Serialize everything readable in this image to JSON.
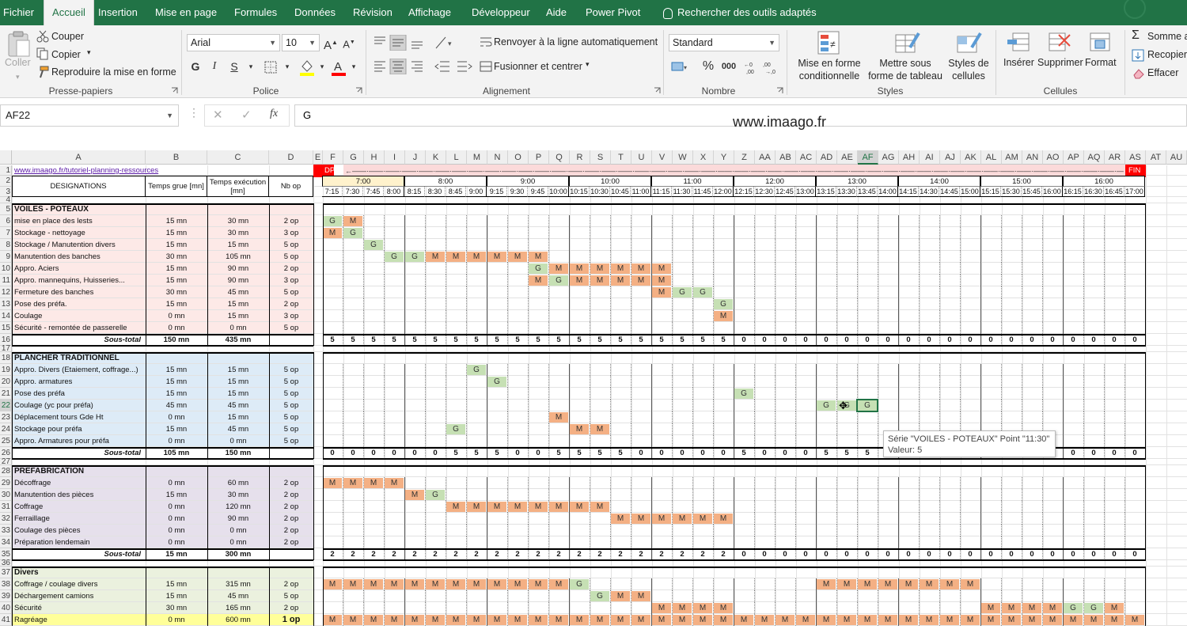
{
  "ribbon_tabs": [
    "Fichier",
    "Accueil",
    "Insertion",
    "Mise en page",
    "Formules",
    "Données",
    "Révision",
    "Affichage",
    "Développeur",
    "Aide",
    "Power Pivot",
    "Rechercher des outils adaptés"
  ],
  "ribbon": {
    "clipboard": {
      "paste": "Coller",
      "cut": "Couper",
      "copy": "Copier",
      "format_painter": "Reproduire la mise en forme",
      "label": "Presse-papiers"
    },
    "font": {
      "name": "Arial",
      "size": "10",
      "bold": "G",
      "italic": "I",
      "underline": "S",
      "label": "Police"
    },
    "alignment": {
      "wrap": "Renvoyer à la ligne automatiquement",
      "merge": "Fusionner et centrer",
      "label": "Alignement"
    },
    "number": {
      "format": "Standard",
      "label": "Nombre"
    },
    "styles": {
      "conditional": "Mise en forme conditionnelle",
      "table": "Mettre sous forme de tableau",
      "cell_styles": "Styles de cellules",
      "label": "Styles"
    },
    "cells": {
      "insert": "Insérer",
      "delete": "Supprimer",
      "format": "Format",
      "label": "Cellules"
    },
    "editing": {
      "autosum": "Somme a",
      "fill": "Recopier",
      "clear": "Effacer"
    }
  },
  "formula_bar": {
    "name_box": "AF22",
    "value": "G"
  },
  "watermark": "www.imaago.fr",
  "columns": [
    "A",
    "B",
    "C",
    "D",
    "E",
    "F",
    "G",
    "H",
    "I",
    "J",
    "K",
    "L",
    "M",
    "N",
    "O",
    "P",
    "Q",
    "R",
    "S",
    "T",
    "U",
    "V",
    "W",
    "X",
    "Y",
    "Z",
    "AA",
    "AB",
    "AC",
    "AD",
    "AE",
    "AF",
    "AG",
    "AH",
    "AI",
    "AJ",
    "AK",
    "AL",
    "AM",
    "AN",
    "AO",
    "AP",
    "AQ",
    "AR",
    "AS",
    "AT",
    "AU"
  ],
  "selected_column": "AF",
  "selected_row": "22",
  "header": {
    "link": "www.imaago.fr/tutoriel-planning-ressources",
    "designations": "DESIGNATIONS",
    "crane_time": "Temps grue [mn]",
    "exec_time": "Temps exécution [mn]",
    "nb_op": "Nb op",
    "start": "DPT",
    "end": "FIN",
    "arrow_text": "←——·——·——·——·——·——·——·——·——·——·——·——·——·——·——·——·——·——·——·——·——·——·——·——·——·——·——·——·——·——·——·——·——·——·——·——·——·——·——·——·——·——·——·——·——·——·——·——·——·——·——·——·——·——·——·——·——·——·——·——·——·——·——·——·——·——·——·——→"
  },
  "hours": [
    "7:00",
    "8:00",
    "9:00",
    "10:00",
    "11:00",
    "12:00",
    "13:00",
    "14:00",
    "15:00",
    "16:00"
  ],
  "quarters": [
    "7:15",
    "7:30",
    "7:45",
    "8:00",
    "8:15",
    "8:30",
    "8:45",
    "9:00",
    "9:15",
    "9:30",
    "9:45",
    "10:00",
    "10:15",
    "10:30",
    "10:45",
    "11:00",
    "11:15",
    "11:30",
    "11:45",
    "12:00",
    "12:15",
    "12:30",
    "12:45",
    "13:00",
    "13:15",
    "13:30",
    "13:45",
    "14:00",
    "14:15",
    "14:30",
    "14:45",
    "15:00",
    "15:15",
    "15:30",
    "15:45",
    "16:00",
    "16:15",
    "16:30",
    "16:45",
    "17:00"
  ],
  "rows": [
    {
      "n": "1",
      "type": "link"
    },
    {
      "n": "2",
      "type": "hdr"
    },
    {
      "n": "3",
      "type": "hdr"
    },
    {
      "n": "4",
      "type": "blank"
    },
    {
      "n": "5",
      "type": "section",
      "label": "VOILES - POTEAUX",
      "bg": "#fde9e7"
    },
    {
      "n": "6",
      "type": "task",
      "label": "mise en place des lests",
      "crane": "15 mn",
      "exec": "30 mn",
      "op": "2 op",
      "bg": "#fde9e7",
      "marks": "GM"
    },
    {
      "n": "7",
      "type": "task",
      "label": "Stockage - nettoyage",
      "crane": "15 mn",
      "exec": "30 mn",
      "op": "3 op",
      "bg": "#fde9e7",
      "marks": "MG"
    },
    {
      "n": "8",
      "type": "task",
      "label": "Stockage / Manutention divers",
      "crane": "15 mn",
      "exec": "15 mn",
      "op": "5 op",
      "bg": "#fde9e7",
      "marks": "..G"
    },
    {
      "n": "9",
      "type": "task",
      "label": "Manutention des banches",
      "crane": "30 mn",
      "exec": "105 mn",
      "op": "5 op",
      "bg": "#fde9e7",
      "marks": "...GGMMMMMM"
    },
    {
      "n": "10",
      "type": "task",
      "label": "Appro. Aciers",
      "crane": "15 mn",
      "exec": "90 mn",
      "op": "2 op",
      "bg": "#fde9e7",
      "marks": "..........GMMMMMM"
    },
    {
      "n": "11",
      "type": "task",
      "label": "Appro. mannequins, Huisseries...",
      "crane": "15 mn",
      "exec": "90 mn",
      "op": "3 op",
      "bg": "#fde9e7",
      "marks": "..........MGMMMMM"
    },
    {
      "n": "12",
      "type": "task",
      "label": "Fermeture des banches",
      "crane": "30 mn",
      "exec": "45 mn",
      "op": "5 op",
      "bg": "#fde9e7",
      "marks": "................MGG"
    },
    {
      "n": "13",
      "type": "task",
      "label": "Pose des préfa.",
      "crane": "15 mn",
      "exec": "15 mn",
      "op": "2 op",
      "bg": "#fde9e7",
      "marks": "...................G"
    },
    {
      "n": "14",
      "type": "task",
      "label": "Coulage",
      "crane": "0 mn",
      "exec": "15 mn",
      "op": "3 op",
      "bg": "#fde9e7",
      "marks": "...................M"
    },
    {
      "n": "15",
      "type": "task",
      "label": "Sécurité - remontée de passerelle",
      "crane": "0 mn",
      "exec": "0 mn",
      "op": "5 op",
      "bg": "#fde9e7",
      "marks": ""
    },
    {
      "n": "16",
      "type": "subtotal",
      "label": "Sous-total",
      "crane": "150 mn",
      "exec": "435 mn",
      "vals": "5555555555555555555500000000000000000000"
    },
    {
      "n": "17",
      "type": "blank"
    },
    {
      "n": "18",
      "type": "section",
      "label": "PLANCHER TRADITIONNEL",
      "bg": "#ddebf7"
    },
    {
      "n": "19",
      "type": "task",
      "label": "Appro. Divers (Etaiement, coffrage...)",
      "crane": "15 mn",
      "exec": "15 mn",
      "op": "5 op",
      "bg": "#ddebf7",
      "marks": ".......G"
    },
    {
      "n": "20",
      "type": "task",
      "label": "Appro. armatures",
      "crane": "15 mn",
      "exec": "15 mn",
      "op": "5 op",
      "bg": "#ddebf7",
      "marks": "........G"
    },
    {
      "n": "21",
      "type": "task",
      "label": "Pose des préfa",
      "crane": "15 mn",
      "exec": "15 mn",
      "op": "5 op",
      "bg": "#ddebf7",
      "marks": "....................G"
    },
    {
      "n": "22",
      "type": "task",
      "label": "Coulage (yc pour préfa)",
      "crane": "45 mn",
      "exec": "45 mn",
      "op": "5 op",
      "bg": "#ddebf7",
      "marks": "........................GGG"
    },
    {
      "n": "23",
      "type": "task",
      "label": "Déplacement tours Gde Ht",
      "crane": "0 mn",
      "exec": "15 mn",
      "op": "5 op",
      "bg": "#ddebf7",
      "marks": "...........M"
    },
    {
      "n": "24",
      "type": "task",
      "label": "Stockage pour préfa",
      "crane": "15 mn",
      "exec": "45 mn",
      "op": "5 op",
      "bg": "#ddebf7",
      "marks": "......G.....MM"
    },
    {
      "n": "25",
      "type": "task",
      "label": "Appro. Armatures pour préfa",
      "crane": "0 mn",
      "exec": "0 mn",
      "op": "5 op",
      "bg": "#ddebf7",
      "marks": ""
    },
    {
      "n": "26",
      "type": "subtotal",
      "label": "Sous-total",
      "crane": "105 mn",
      "exec": "150 mn",
      "vals": "0000005550055550000050005550000000000000"
    },
    {
      "n": "27",
      "type": "blank"
    },
    {
      "n": "28",
      "type": "section",
      "label": "PREFABRICATION",
      "bg": "#e6e0ec"
    },
    {
      "n": "29",
      "type": "task",
      "label": "Décoffrage",
      "crane": "0 mn",
      "exec": "60 mn",
      "op": "2 op",
      "bg": "#e6e0ec",
      "marks": "MMMM"
    },
    {
      "n": "30",
      "type": "task",
      "label": "Manutention des pièces",
      "crane": "15 mn",
      "exec": "30 mn",
      "op": "2 op",
      "bg": "#e6e0ec",
      "marks": "....MG"
    },
    {
      "n": "31",
      "type": "task",
      "label": "Coffrage",
      "crane": "0 mn",
      "exec": "120 mn",
      "op": "2 op",
      "bg": "#e6e0ec",
      "marks": "......MMMMMMMM"
    },
    {
      "n": "32",
      "type": "task",
      "label": "Ferraillage",
      "crane": "0 mn",
      "exec": "90 mn",
      "op": "2 op",
      "bg": "#e6e0ec",
      "marks": "..............MMMMMM"
    },
    {
      "n": "33",
      "type": "task",
      "label": "Coulage des pièces",
      "crane": "0 mn",
      "exec": "0 mn",
      "op": "2 op",
      "bg": "#e6e0ec",
      "marks": ""
    },
    {
      "n": "34",
      "type": "task",
      "label": "Préparation lendemain",
      "crane": "0 mn",
      "exec": "0 mn",
      "op": "2 op",
      "bg": "#e6e0ec",
      "marks": ""
    },
    {
      "n": "35",
      "type": "subtotal",
      "label": "Sous-total",
      "crane": "15 mn",
      "exec": "300 mn",
      "vals": "2222222222222222222200000000000000000000"
    },
    {
      "n": "36",
      "type": "blank"
    },
    {
      "n": "37",
      "type": "section",
      "label": "Divers",
      "bg": "#ebf1de"
    },
    {
      "n": "38",
      "type": "task",
      "label": "Coffrage / coulage divers",
      "crane": "15 mn",
      "exec": "315 mn",
      "op": "2 op",
      "bg": "#ebf1de",
      "marks": "MMMMMMMMMMMMG...........MMMMMMMM"
    },
    {
      "n": "39",
      "type": "task",
      "label": "Déchargement camions",
      "crane": "15 mn",
      "exec": "45 mn",
      "op": "5 op",
      "bg": "#ebf1de",
      "marks": ".............GMM"
    },
    {
      "n": "40",
      "type": "task",
      "label": "Sécurité",
      "crane": "30 mn",
      "exec": "165 mn",
      "op": "2 op",
      "bg": "#ebf1de",
      "marks": "................MMMM............MMMMGGM"
    },
    {
      "n": "41",
      "type": "task",
      "label": "Ragréage",
      "crane": "0 mn",
      "exec": "600 mn",
      "op": "1 op",
      "bg": "#ffff99",
      "op_bold": true,
      "marks": "MMMMMMMMMMMMMMMMMMMMMMMMMMMMMMMMMMMMMMMM"
    }
  ],
  "tooltip": {
    "line1": "Série \"VOILES - POTEAUX\" Point \"11:30\"",
    "line2": "Valeur: 5"
  },
  "colors": {
    "excel_green": "#217346",
    "crane": "#c6e0b4",
    "exec": "#f4b084",
    "dpt_red": "#ff0000",
    "arrow_band": "#fbdada",
    "hour_hl": "#fff2cc"
  }
}
